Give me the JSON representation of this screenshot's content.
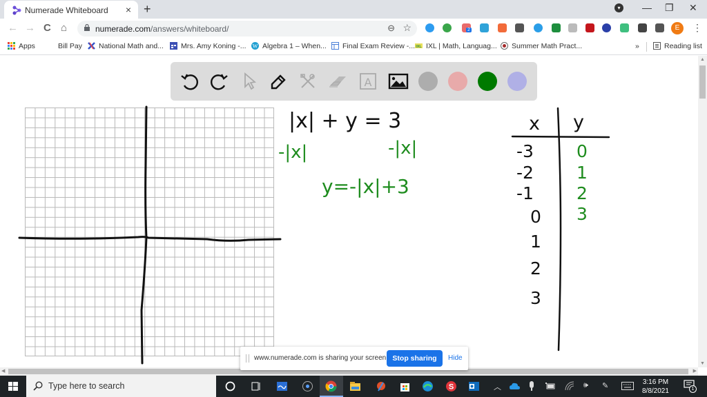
{
  "browser": {
    "tab": {
      "title": "Numerade Whiteboard",
      "close": "×"
    },
    "new_tab": "+",
    "window_controls": {
      "profile": "▾",
      "minimize": "—",
      "restore": "❐",
      "close": "✕"
    },
    "nav": {
      "back": "←",
      "forward": "→",
      "reload": "C",
      "home": "⌂"
    },
    "omnibox": {
      "domain": "numerade.com",
      "path": "/answers/whiteboard/",
      "zoom_icon": "⊖",
      "star_icon": "☆"
    },
    "extensions": [
      {
        "name": "safari-ext",
        "color": "#2d9cf0"
      },
      {
        "name": "plus-ext",
        "color": "#3aa64a"
      },
      {
        "name": "badge-ext",
        "color": "#e96b6b",
        "badge": "2"
      },
      {
        "name": "cloud-ext",
        "color": "#2fa3d9"
      },
      {
        "name": "bookmark-ext",
        "color": "#f26b3a"
      },
      {
        "name": "grid-ext",
        "color": "#555555"
      },
      {
        "name": "diamond-ext",
        "color": "#2b9ee8"
      },
      {
        "name": "cast-green-ext",
        "color": "#1e8e3e"
      },
      {
        "name": "dim-ext",
        "color": "#bbbbbb"
      },
      {
        "name": "pdf-ext",
        "color": "#c4161c"
      },
      {
        "name": "k-ext",
        "color": "#2a3fa8"
      },
      {
        "name": "smile-ext",
        "color": "#3fbf7f"
      },
      {
        "name": "puzzle-ext",
        "color": "#444444"
      },
      {
        "name": "cast-ext",
        "color": "#555555"
      }
    ],
    "profile_initial": "E",
    "menu": "⋮",
    "bookmarks": [
      {
        "label": "Apps",
        "icon": "apps-icon"
      },
      {
        "label": "Bill Pay",
        "icon": ""
      },
      {
        "label": "National Math and...",
        "icon": "x-logo-icon"
      },
      {
        "label": "Mrs. Amy Koning -...",
        "icon": "calendar-icon"
      },
      {
        "label": "Algebra 1 – When...",
        "icon": "wordpress-icon"
      },
      {
        "label": "Final Exam Review -...",
        "icon": "form-icon"
      },
      {
        "label": "IXL | Math, Languag...",
        "icon": "ixl-icon"
      },
      {
        "label": "Summer Math Pract...",
        "icon": "circle-logo-icon"
      }
    ],
    "bookmarks_overflow": "»",
    "reading_list": "Reading list"
  },
  "whiteboard": {
    "tools": [
      "undo",
      "redo",
      "select",
      "pen",
      "tools",
      "eraser",
      "text",
      "image"
    ],
    "text_tool_glyph": "A",
    "colors": [
      "#adadad",
      "#e8aaaa",
      "#007a00",
      "#b0b0e6"
    ],
    "ink_colors": {
      "black": "#111111",
      "green": "#1e8c1e"
    },
    "equations": {
      "line1": "|x| + y = 3",
      "line2_left": "-|x|",
      "line2_right": "-|x|",
      "line3": "y=-|x|+3"
    },
    "table": {
      "headers": [
        "x",
        "y"
      ],
      "x_values": [
        "-3",
        "-2",
        "-1",
        "0",
        "1",
        "2",
        "3"
      ],
      "y_values": [
        "0",
        "1",
        "2",
        "3"
      ]
    }
  },
  "sharing_bar": {
    "message": "www.numerade.com is sharing your screen.",
    "stop_label": "Stop sharing",
    "hide_label": "Hide"
  },
  "taskbar": {
    "search_placeholder": "Type here to search",
    "time": "3:16 PM",
    "date": "8/8/2021",
    "notification_count": "1"
  }
}
